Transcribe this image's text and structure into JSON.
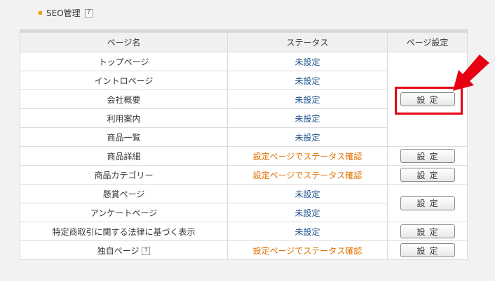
{
  "section": {
    "title": "SEO管理",
    "help_label": "?"
  },
  "table": {
    "headers": {
      "name": "ページ名",
      "status": "ステータス",
      "settings": "ページ設定"
    },
    "rows": [
      {
        "name": "トップページ",
        "status": "未設定"
      },
      {
        "name": "イントロページ",
        "status": "未設定"
      },
      {
        "name": "会社概要",
        "status": "未設定"
      },
      {
        "name": "利用案内",
        "status": "未設定"
      },
      {
        "name": "商品一覧",
        "status": "未設定"
      },
      {
        "name": "商品詳細",
        "status": "設定ページでステータス確認"
      },
      {
        "name": "商品カテゴリー",
        "status": "設定ページでステータス確認"
      },
      {
        "name": "懸賞ページ",
        "status": "未設定"
      },
      {
        "name": "アンケートページ",
        "status": "未設定"
      },
      {
        "name": "特定商取引に関する法律に基づく表示",
        "status": "未設定"
      },
      {
        "name": "独自ページ",
        "status": "設定ページでステータス確認",
        "help": "?"
      }
    ],
    "button_label": "設定"
  },
  "colors": {
    "unset_status": "#1c4f8a",
    "check_status": "#e07000",
    "highlight": "#e60012",
    "bullet": "#f39800"
  },
  "annotation": {
    "arrow_icon": "red-arrow-icon"
  }
}
